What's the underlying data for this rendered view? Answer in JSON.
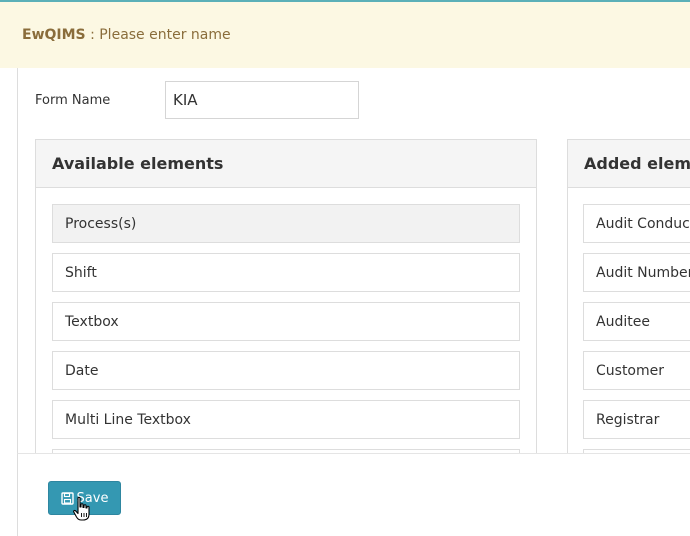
{
  "alert": {
    "brand": "EwQIMS",
    "message": " : Please enter name"
  },
  "form": {
    "name_label": "Form Name",
    "name_value": "KIA"
  },
  "available": {
    "heading": "Available elements",
    "items": [
      {
        "label": "Process(s)"
      },
      {
        "label": "Shift"
      },
      {
        "label": "Textbox"
      },
      {
        "label": "Date"
      },
      {
        "label": "Multi Line Textbox"
      }
    ]
  },
  "added": {
    "heading": "Added elements",
    "items": [
      {
        "label": "Audit Conducted By"
      },
      {
        "label": "Audit Number"
      },
      {
        "label": "Auditee"
      },
      {
        "label": "Customer"
      },
      {
        "label": "Registrar"
      }
    ]
  },
  "footer": {
    "save_label": "Save",
    "save_icon": "floppy-disk-icon"
  }
}
